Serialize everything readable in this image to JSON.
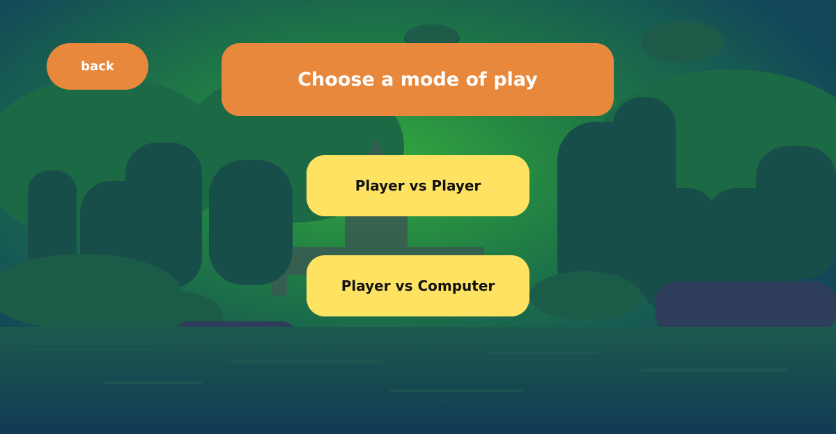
{
  "colors": {
    "sky_top": "#1b4a63",
    "sky_glow": "#2a8a3c",
    "ground": "#1a4e4c",
    "orange": "#e8883c",
    "yellow": "#fee262"
  },
  "header": {
    "back_label": "back",
    "title": "Choose a mode of play"
  },
  "modes": [
    {
      "label": "Player vs Player"
    },
    {
      "label": "Player vs Computer"
    }
  ]
}
